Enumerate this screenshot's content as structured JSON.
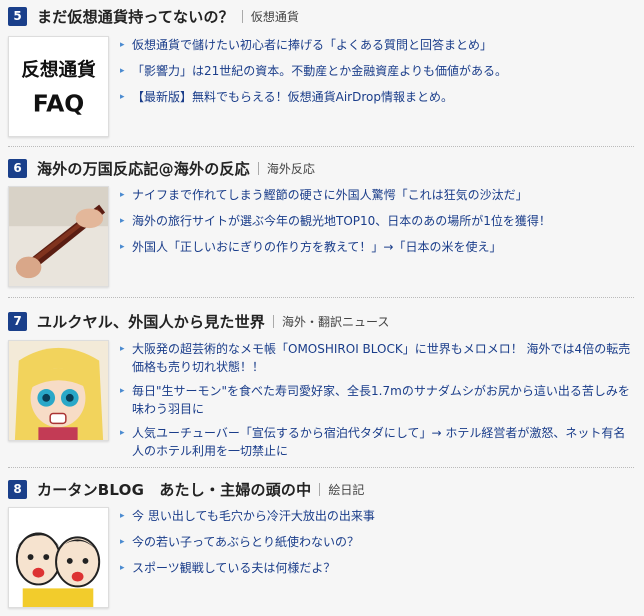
{
  "entries": [
    {
      "rank": "5",
      "title": "まだ仮想通貨持ってないの？",
      "category": "仮想通貨",
      "thumb_icon": "faq-text-thumbnail",
      "thumb_text": [
        "反想通貨",
        "FAQ"
      ],
      "links": [
        "仮想通貨で儲けたい初心者に捧げる「よくある質問と回答まとめ」",
        "「影響力」は21世紀の資本。不動産とか金融資産よりも価値がある。",
        "【最新版】無料でもらえる！仮想通貨AirDrop情報まとめ。"
      ]
    },
    {
      "rank": "6",
      "title": "海外の万国反応記@海外の反応",
      "category": "海外反応",
      "thumb_icon": "bonito-fish-photo",
      "links": [
        "ナイフまで作れてしまう鰹節の硬さに外国人驚愕「これは狂気の沙汰だ」",
        "海外の旅行サイトが選ぶ今年の観光地TOP10、日本のあの場所が1位を獲得！",
        "外国人「正しいおにぎりの作り方を教えて！」→「日本の米を使え」"
      ]
    },
    {
      "rank": "7",
      "title": "ユルクヤル、外国人から見た世界",
      "category": "海外・翻訳ニュース",
      "thumb_icon": "anime-girl-image",
      "links": [
        "大阪発の超芸術的なメモ帳「OMOSHIROI BLOCK」に世界もメロメロ！ 海外では4倍の転売価格も売り切れ状態！！",
        "毎日\"生サーモン\"を食べた寿司愛好家、全長1.7mのサナダムシがお尻から這い出る苦しみを味わう羽目に",
        "人気ユーチューバー「宣伝するから宿泊代タダにして」→ ホテル経営者が激怒、ネット有名人のホテル利用を一切禁止に"
      ]
    },
    {
      "rank": "8",
      "title": "カータンBLOG　あたし・主婦の頭の中",
      "category": "絵日記",
      "thumb_icon": "cartoon-faces-image",
      "links": [
        "今 思い出しても毛穴から冷汗大放出の出来事",
        "今の若い子ってあぶらとり紙使わないの？",
        "スポーツ観戦している夫は何様だよ？"
      ]
    }
  ]
}
